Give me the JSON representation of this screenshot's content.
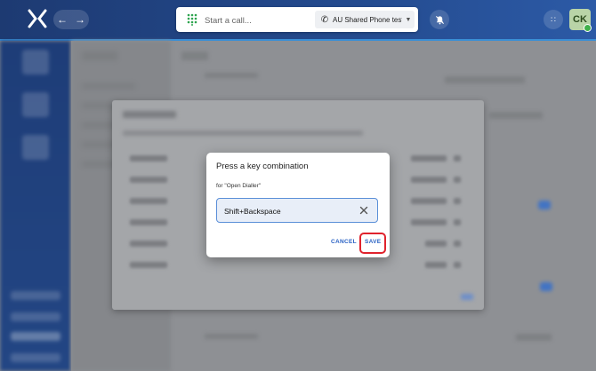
{
  "topbar": {
    "call_placeholder": "Start a call...",
    "line_selector": "AU Shared Phone testi...",
    "avatar_initials": "CK",
    "icons": {
      "logo": "x-logo-icon",
      "back": "arrow-left-icon",
      "forward": "arrow-right-icon",
      "dialpad": "dialpad-icon",
      "phone": "phone-icon",
      "dropdown": "chevron-down-icon",
      "notifications": "bell-off-icon",
      "apps": "apps-icon"
    }
  },
  "dialog": {
    "title": "Press a key combination",
    "subtitle": "for \"Open Dialler\"",
    "combo_value": "Shift+Backspace",
    "cancel_label": "CANCEL",
    "save_label": "SAVE"
  },
  "colors": {
    "topbar": "#244b8f",
    "accent": "#3a8fd6",
    "button_text": "#2a62c4",
    "highlight": "#e0232d",
    "presence": "#3fb04a"
  }
}
